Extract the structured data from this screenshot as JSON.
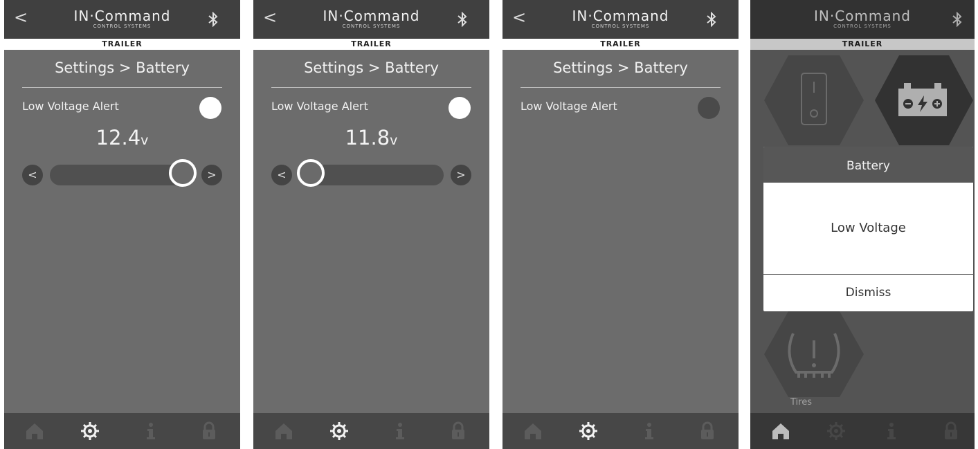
{
  "brand": {
    "name": "IN·Command",
    "subtitle": "CONTROL SYSTEMS",
    "section": "TRAILER"
  },
  "colors": {
    "background": "#6c6c6c",
    "header": "#404040",
    "footer": "#474747"
  },
  "nav_icons": [
    "home-icon",
    "gear-icon",
    "info-icon",
    "lock-icon"
  ],
  "screens": [
    {
      "page_title": "Settings > Battery",
      "alert_label": "Low Voltage Alert",
      "alert_on": true,
      "voltage": "12.4",
      "unit": "v",
      "slider_fraction": 0.92
    },
    {
      "page_title": "Settings > Battery",
      "alert_label": "Low Voltage Alert",
      "alert_on": true,
      "voltage": "11.8",
      "unit": "v",
      "slider_fraction": 0.08
    },
    {
      "page_title": "Settings > Battery",
      "alert_label": "Low Voltage Alert",
      "alert_on": false
    },
    {
      "tiles": [
        {
          "icon": "switch-icon"
        },
        {
          "icon": "battery-icon"
        },
        {
          "label": "Tires",
          "icon": "tire-pressure-icon"
        }
      ],
      "dialog": {
        "title": "Battery",
        "message": "Low Voltage",
        "dismiss_label": "Dismiss"
      }
    }
  ]
}
